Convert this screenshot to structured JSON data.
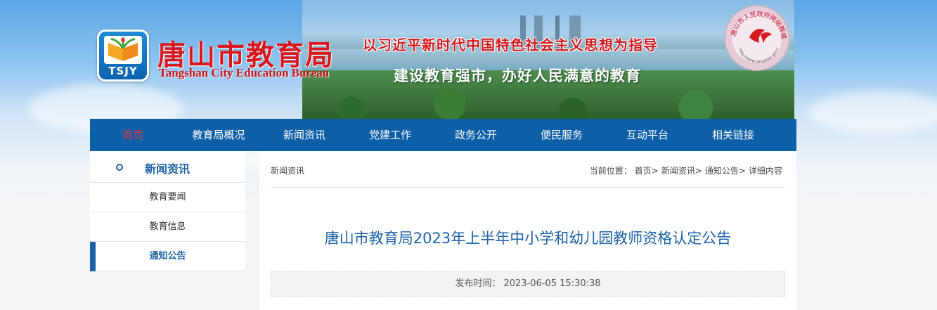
{
  "header": {
    "logo_letters": "TSJY",
    "site_name": "唐山市教育局",
    "site_name_en": "Tangshan City Education Bureau",
    "slogan_line1": "以习近平新时代中国特色社会主义思想为指导",
    "slogan_line2": "建设教育强市，办好人民满意的教育",
    "seal_text": "唐山市人民政府网站群成员",
    "seal_url": "http://www.tangshan.gov.cn"
  },
  "nav": {
    "items": [
      {
        "label": "首页",
        "active": true
      },
      {
        "label": "教育局概况"
      },
      {
        "label": "新闻资讯"
      },
      {
        "label": "党建工作"
      },
      {
        "label": "政务公开"
      },
      {
        "label": "便民服务"
      },
      {
        "label": "互动平台"
      },
      {
        "label": "相关链接"
      }
    ]
  },
  "sidebar": {
    "heading": "新闻资讯",
    "items": [
      {
        "label": "教育要闻"
      },
      {
        "label": "教育信息"
      },
      {
        "label": "通知公告",
        "active": true
      }
    ]
  },
  "main": {
    "section_label": "新闻资讯",
    "breadcrumb_prefix": "当前位置：",
    "breadcrumb": [
      "首页>",
      "新闻资讯>",
      "通知公告>",
      "详细内容"
    ],
    "article_title": "唐山市教育局2023年上半年中小学和幼儿园教师资格认定公告",
    "publish_label": "发布时间：",
    "publish_time": "2023-06-05 15:30:38"
  },
  "colors": {
    "nav_bg": "#0d5fa8",
    "accent_blue": "#1d62a8",
    "brand_red": "#d7181f"
  }
}
